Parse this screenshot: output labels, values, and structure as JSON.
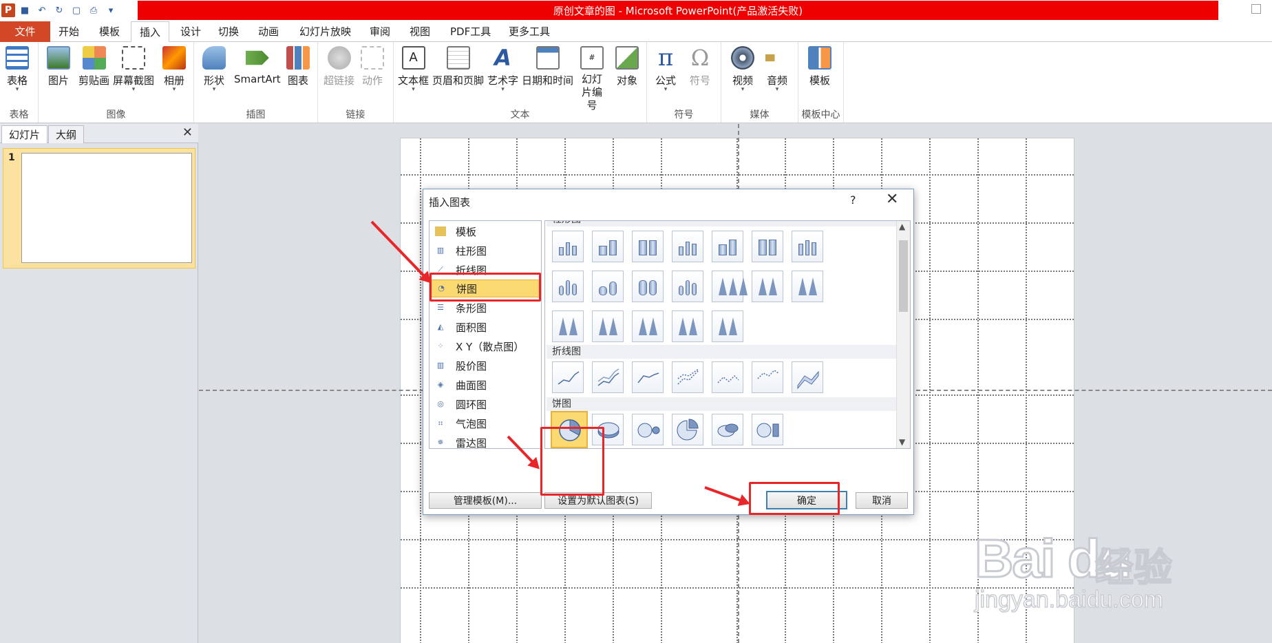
{
  "app": {
    "title": "原创文章的图 - Microsoft PowerPoint(产品激活失败)",
    "logo": "P"
  },
  "qat": {
    "icons": [
      "save-icon",
      "undo-icon",
      "redo-icon",
      "new-icon",
      "print-icon",
      "customize-icon"
    ]
  },
  "tabs": [
    "文件",
    "开始",
    "模板",
    "插入",
    "设计",
    "切换",
    "动画",
    "幻灯片放映",
    "审阅",
    "视图",
    "PDF工具",
    "更多工具"
  ],
  "ribbon": {
    "groups": [
      {
        "label": "表格",
        "buttons": [
          "表格"
        ]
      },
      {
        "label": "图像",
        "buttons": [
          "图片",
          "剪贴画",
          "屏幕截图",
          "相册"
        ]
      },
      {
        "label": "插图",
        "buttons": [
          "形状",
          "SmartArt",
          "图表"
        ]
      },
      {
        "label": "链接",
        "buttons": [
          "超链接",
          "动作"
        ]
      },
      {
        "label": "文本",
        "buttons": [
          "文本框",
          "页眉和页脚",
          "艺术字",
          "日期和时间",
          "幻灯片编号",
          "对象"
        ]
      },
      {
        "label": "符号",
        "buttons": [
          "公式",
          "符号"
        ]
      },
      {
        "label": "媒体",
        "buttons": [
          "视频",
          "音频"
        ]
      },
      {
        "label": "模板中心",
        "buttons": [
          "模板"
        ]
      }
    ]
  },
  "leftpane": {
    "tab_slides": "幻灯片",
    "tab_outline": "大纲",
    "close": "✕",
    "slide_number": "1"
  },
  "dialog": {
    "title": "插入图表",
    "help": "?",
    "close": "✕",
    "categories": [
      "模板",
      "柱形图",
      "折线图",
      "饼图",
      "条形图",
      "面积图",
      "X Y（散点图）",
      "股价图",
      "曲面图",
      "圆环图",
      "气泡图",
      "雷达图"
    ],
    "selected_category": "饼图",
    "section_top": "柱形图",
    "section_line": "折线图",
    "section_pie": "饼图",
    "manage_templates": "管理模板(M)...",
    "set_default": "设置为默认图表(S)",
    "ok": "确定",
    "cancel": "取消"
  },
  "watermark": {
    "logo_text": "Bai du",
    "brand": "经验",
    "url": "jingyan.baidu.com"
  },
  "colors": {
    "file_tab": "#d24726",
    "title_bar": "#ee0000",
    "highlight": "#e8262a",
    "selection": "#fbd971"
  }
}
